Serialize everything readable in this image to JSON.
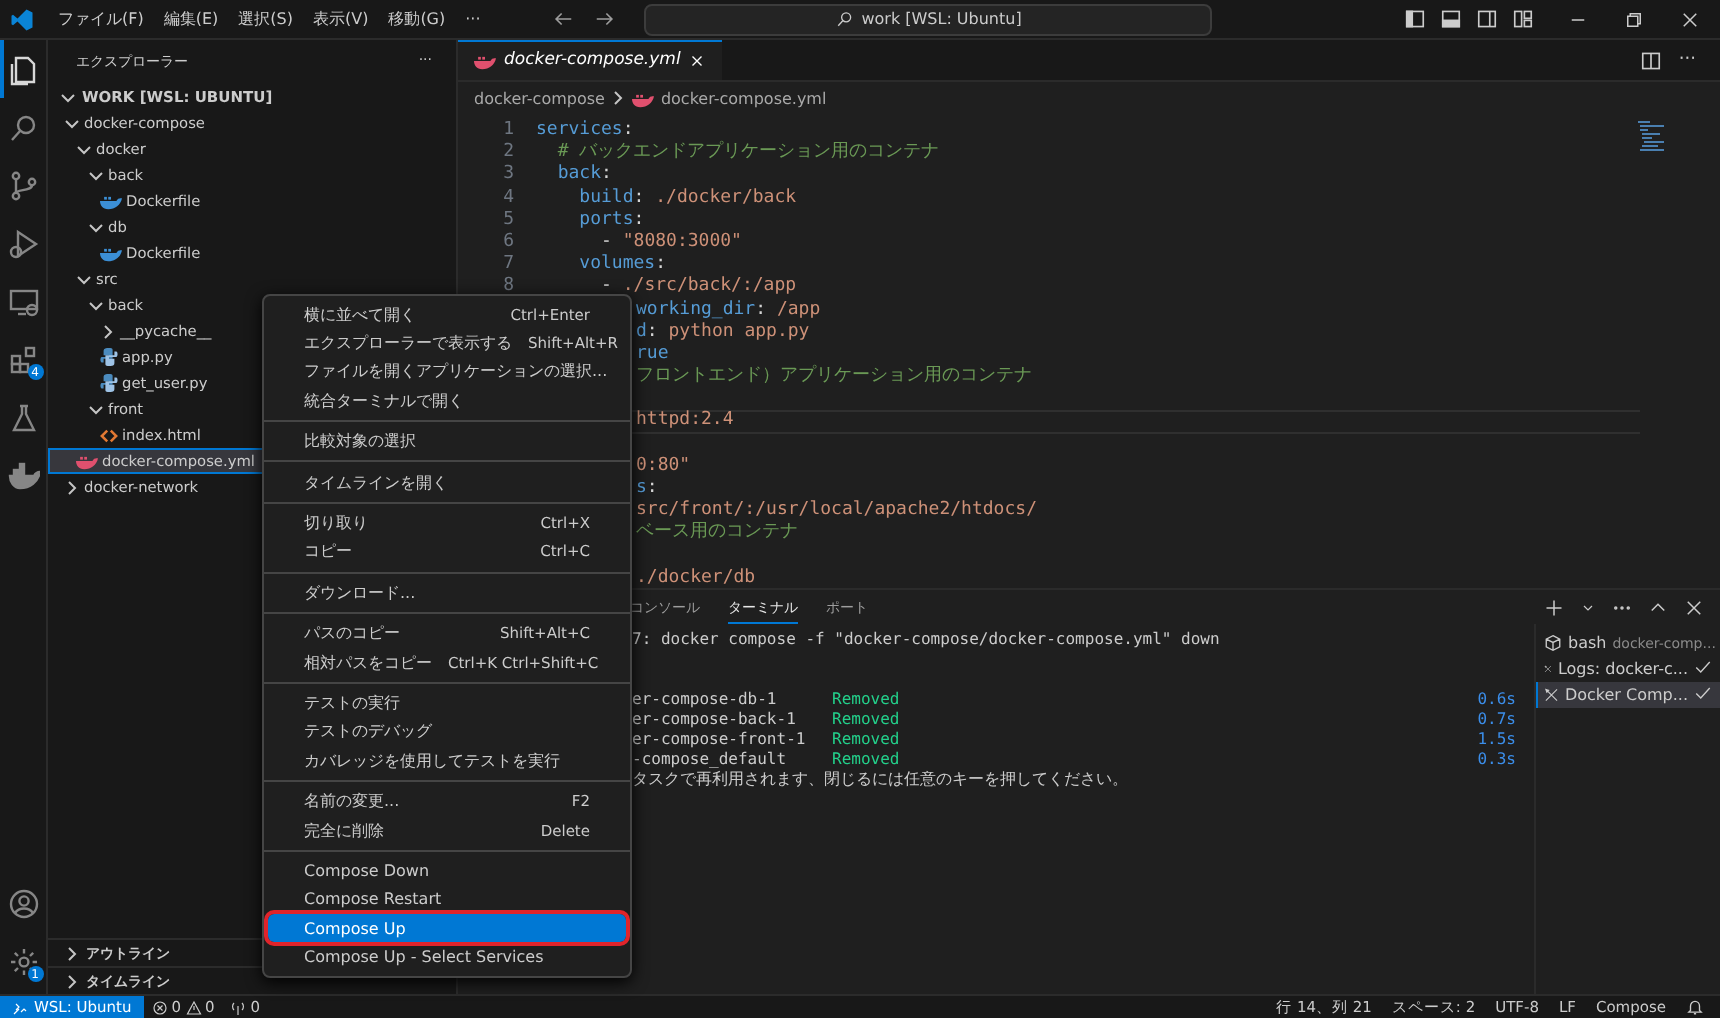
{
  "title_bar": {
    "menus": [
      "ファイル(F)",
      "編集(E)",
      "選択(S)",
      "表示(V)",
      "移動(G)",
      "···"
    ],
    "search": "work [WSL: Ubuntu]"
  },
  "activity_bar": {
    "items": [
      {
        "kind": "files",
        "selected": true
      },
      {
        "kind": "search",
        "selected": false
      },
      {
        "kind": "source",
        "selected": false
      },
      {
        "kind": "debug",
        "selected": false
      },
      {
        "kind": "remote",
        "selected": false
      },
      {
        "kind": "extensions",
        "selected": false,
        "badge": "4"
      },
      {
        "kind": "testing",
        "selected": false
      },
      {
        "kind": "docker",
        "selected": false
      }
    ],
    "bottom": [
      {
        "kind": "account"
      },
      {
        "kind": "settings",
        "badge": "1"
      }
    ]
  },
  "sidebar": {
    "title": "エクスプローラー",
    "more": "···",
    "root": "WORK [WSL: UBUNTU]",
    "tree": [
      {
        "label": "docker-compose",
        "kind": "folder",
        "expanded": true,
        "selected": false,
        "children": [
          {
            "label": "docker",
            "kind": "folder",
            "expanded": true,
            "selected": false,
            "children": [
              {
                "label": "back",
                "kind": "folder",
                "expanded": true,
                "selected": false,
                "children": [
                  {
                    "label": "Dockerfile",
                    "kind": "docker",
                    "selected": false
                  }
                ]
              },
              {
                "label": "db",
                "kind": "folder",
                "expanded": true,
                "selected": false,
                "children": [
                  {
                    "label": "Dockerfile",
                    "kind": "docker",
                    "selected": false
                  }
                ]
              }
            ]
          },
          {
            "label": "src",
            "kind": "folder",
            "expanded": true,
            "selected": false,
            "children": [
              {
                "label": "back",
                "kind": "folder",
                "expanded": true,
                "selected": false,
                "children": [
                  {
                    "label": "__pycache__",
                    "kind": "folder",
                    "expanded": false,
                    "selected": false
                  },
                  {
                    "label": "app.py",
                    "kind": "python",
                    "selected": false
                  },
                  {
                    "label": "get_user.py",
                    "kind": "python",
                    "selected": false
                  }
                ]
              },
              {
                "label": "front",
                "kind": "folder",
                "expanded": true,
                "selected": false,
                "children": [
                  {
                    "label": "index.html",
                    "kind": "html",
                    "selected": false
                  }
                ]
              }
            ]
          },
          {
            "label": "docker-compose.yml",
            "kind": "yaml",
            "selected": true
          }
        ]
      },
      {
        "label": "docker-network",
        "kind": "folder",
        "expanded": false,
        "selected": false
      }
    ],
    "sections": [
      {
        "label": "アウトライン",
        "expanded": false
      },
      {
        "label": "タイムライン",
        "expanded": false
      }
    ]
  },
  "editor": {
    "tabs": [
      {
        "label": "docker-compose.yml",
        "selected": true
      }
    ],
    "breadcrumbs": [
      "docker-compose",
      "docker-compose.yml"
    ],
    "lines": [
      {
        "number": "1",
        "segments": [
          {
            "text": "services",
            "kind": "key"
          },
          {
            "text": ":",
            "kind": "plain"
          }
        ]
      },
      {
        "number": "2",
        "segments": [
          {
            "text": "  # バックエンドアプリケーション用のコンテナ",
            "kind": "cmt"
          }
        ]
      },
      {
        "number": "3",
        "segments": [
          {
            "text": "  back",
            "kind": "key"
          },
          {
            "text": ":",
            "kind": "plain"
          }
        ]
      },
      {
        "number": "4",
        "segments": [
          {
            "text": "    build",
            "kind": "key"
          },
          {
            "text": ": ",
            "kind": "plain"
          },
          {
            "text": "./docker/back",
            "kind": "str"
          }
        ]
      },
      {
        "number": "5",
        "segments": [
          {
            "text": "    ports",
            "kind": "key"
          },
          {
            "text": ":",
            "kind": "plain"
          }
        ]
      },
      {
        "number": "6",
        "segments": [
          {
            "text": "      - ",
            "kind": "plain"
          },
          {
            "text": "\"8080:3000\"",
            "kind": "str"
          }
        ]
      },
      {
        "number": "7",
        "segments": [
          {
            "text": "    volumes",
            "kind": "key"
          },
          {
            "text": ":",
            "kind": "plain"
          }
        ]
      },
      {
        "number": "8",
        "segments": [
          {
            "text": "      - ",
            "kind": "plain"
          },
          {
            "text": "./src/back/:/app",
            "kind": "str"
          }
        ]
      },
      {
        "segments": [
          {
            "text": "working_dir",
            "kind": "key"
          },
          {
            "text": ": ",
            "kind": "plain"
          },
          {
            "text": "/app",
            "kind": "str"
          }
        ]
      },
      {
        "segments": [
          {
            "text": "d",
            "kind": "key"
          },
          {
            "text": ": ",
            "kind": "plain"
          },
          {
            "text": "python app.py",
            "kind": "str"
          }
        ]
      },
      {
        "segments": [
          {
            "text": "rue",
            "kind": "key"
          }
        ]
      },
      {
        "segments": [
          {
            "text": "フロントエンド）アプリケーション用のコンテナ",
            "kind": "cmt"
          }
        ]
      },
      {
        "kind": "blank"
      },
      {
        "segments": [
          {
            "text": "httpd:2.4",
            "kind": "str"
          }
        ],
        "current": true
      },
      {
        "kind": "blank"
      },
      {
        "segments": [
          {
            "text": "0:80\"",
            "kind": "str"
          }
        ]
      },
      {
        "segments": [
          {
            "text": "s",
            "kind": "key"
          },
          {
            "text": ":",
            "kind": "plain"
          }
        ]
      },
      {
        "segments": [
          {
            "text": "src/front/:/usr/local/apache2/htdocs/",
            "kind": "str"
          }
        ]
      },
      {
        "segments": [
          {
            "text": "ベース用のコンテナ",
            "kind": "cmt"
          }
        ]
      },
      {
        "kind": "blank"
      },
      {
        "segments": [
          {
            "text": "./docker/db",
            "kind": "str"
          }
        ]
      }
    ],
    "more": "···"
  },
  "panel": {
    "tabs": [
      {
        "label": "コンソール",
        "selected": false
      },
      {
        "label": "ターミナル",
        "selected": true
      },
      {
        "label": "ポート",
        "selected": false
      }
    ],
    "output": [
      {
        "kind": "command",
        "text": "7: docker compose -f \"docker-compose/docker-compose.yml\" down"
      },
      {
        "kind": "blank"
      },
      {
        "kind": "result",
        "name": "er-compose-db-1",
        "status": "Removed",
        "time": "0.6s"
      },
      {
        "kind": "result",
        "name": "er-compose-back-1",
        "status": "Removed",
        "time": "0.7s"
      },
      {
        "kind": "result",
        "name": "er-compose-front-1",
        "status": "Removed",
        "time": "1.5s"
      },
      {
        "kind": "result",
        "name": "-compose_default",
        "status": "Removed",
        "time": "0.3s"
      },
      {
        "kind": "message",
        "text": "タスクで再利用されます、閉じるには任意のキーを押してください。"
      }
    ],
    "terminals": [
      {
        "kind": "shell",
        "label": "bash",
        "detail": "docker-comp...",
        "done": false,
        "selected": false
      },
      {
        "kind": "task",
        "label": "Logs: docker-c...",
        "done": true,
        "selected": false
      },
      {
        "kind": "task",
        "label": "Docker Comp...",
        "done": true,
        "selected": true
      }
    ]
  },
  "context_menu": {
    "groups": [
      [
        {
          "label": "横に並べて開く",
          "shortcut": "Ctrl+Enter",
          "selected": false
        },
        {
          "label": "エクスプローラーで表示する",
          "shortcut": "Shift+Alt+R",
          "selected": false
        },
        {
          "label": "ファイルを開くアプリケーションの選択...",
          "selected": false
        },
        {
          "label": "統合ターミナルで開く",
          "selected": false
        }
      ],
      [
        {
          "label": "比較対象の選択",
          "selected": false
        }
      ],
      [
        {
          "label": "タイムラインを開く",
          "selected": false
        }
      ],
      [
        {
          "label": "切り取り",
          "shortcut": "Ctrl+X",
          "selected": false
        },
        {
          "label": "コピー",
          "shortcut": "Ctrl+C",
          "selected": false
        }
      ],
      [
        {
          "label": "ダウンロード...",
          "selected": false
        }
      ],
      [
        {
          "label": "パスのコピー",
          "shortcut": "Shift+Alt+C",
          "selected": false
        },
        {
          "label": "相対パスをコピー",
          "shortcut": "Ctrl+K Ctrl+Shift+C",
          "selected": false
        }
      ],
      [
        {
          "label": "テストの実行",
          "selected": false
        },
        {
          "label": "テストのデバッグ",
          "selected": false
        },
        {
          "label": "カバレッジを使用してテストを実行",
          "selected": false
        }
      ],
      [
        {
          "label": "名前の変更...",
          "shortcut": "F2",
          "selected": false
        },
        {
          "label": "完全に削除",
          "shortcut": "Delete",
          "selected": false
        }
      ],
      [
        {
          "label": "Compose Down",
          "selected": false
        },
        {
          "label": "Compose Restart",
          "selected": false
        },
        {
          "label": "Compose Up",
          "selected": true,
          "outlined": true
        },
        {
          "label": "Compose Up - Select Services",
          "selected": false
        }
      ]
    ]
  },
  "status_bar": {
    "remote": "WSL: Ubuntu",
    "errors": "0",
    "warnings": "0",
    "ports": "0",
    "right": [
      "行 14、列 21",
      "スペース: 2",
      "UTF-8",
      "LF",
      "Compose"
    ]
  }
}
